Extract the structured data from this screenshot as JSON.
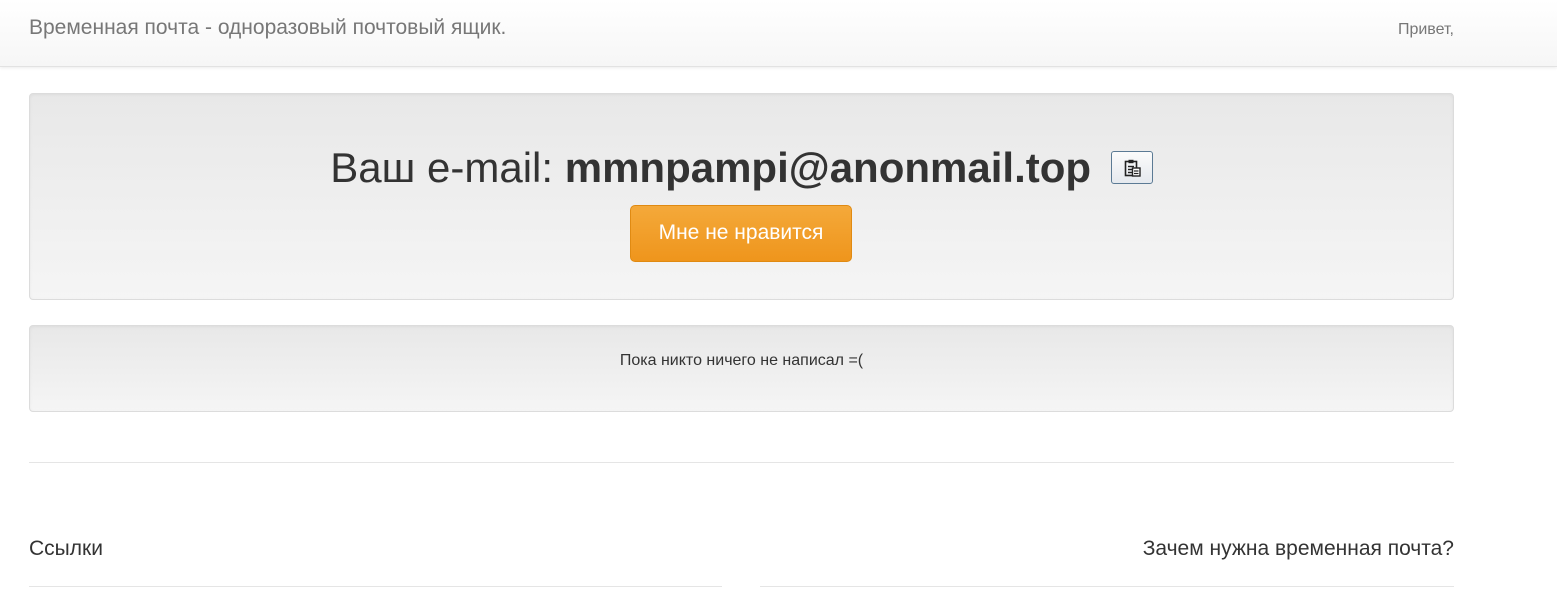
{
  "header": {
    "brand": "Временная почта - одноразовый почтовый ящик.",
    "greeting": "Привет,"
  },
  "email_box": {
    "prefix": "Ваш e-mail:",
    "address": "mmnpampi@anonmail.top",
    "copy_icon": "clipboard-icon",
    "dislike_button": "Мне не нравится",
    "button_color": "#f0a02a"
  },
  "inbox": {
    "empty_message": "Пока никто ничего не написал =("
  },
  "footer": {
    "links_title": "Ссылки",
    "why_title": "Зачем нужна временная почта?"
  }
}
